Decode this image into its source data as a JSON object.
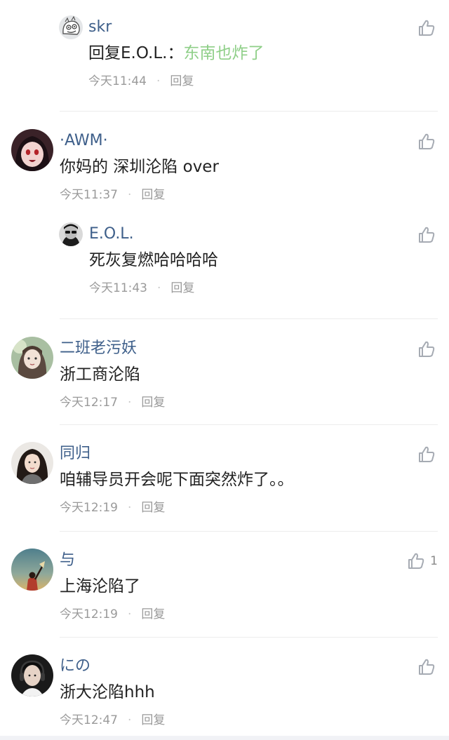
{
  "comments": [
    {
      "nick": "skr",
      "reply_prefix": "回复E.O.L.：",
      "text": "东南也炸了",
      "time": "今天11:44",
      "dot": "·",
      "reply": "回复",
      "likes": "",
      "avatar": "doodle-avatar",
      "colors": {
        "avatar_bg": "#dfe3e6"
      }
    },
    {
      "nick": "·AWM·",
      "text": "你妈的 深圳沦陷 over",
      "time": "今天11:37",
      "dot": "·",
      "reply": "回复",
      "likes": "",
      "avatar": "anime-girl-avatar",
      "colors": {
        "avatar_bg": "#3a2228"
      }
    },
    {
      "nick": "E.O.L.",
      "text": "死灰复燃哈哈哈哈",
      "time": "今天11:43",
      "dot": "·",
      "reply": "回复",
      "likes": "",
      "avatar": "sunglasses-avatar",
      "colors": {
        "avatar_bg": "#2b2b2b"
      }
    },
    {
      "nick": "二班老污妖",
      "text": "浙工商沦陷",
      "time": "今天12:17",
      "dot": "·",
      "reply": "回复",
      "likes": "",
      "avatar": "illustration-avatar",
      "colors": {
        "avatar_bg": "#9fb79a"
      }
    },
    {
      "nick": "同归",
      "text": "咱辅导员开会呢下面突然炸了。。",
      "time": "今天12:19",
      "dot": "·",
      "reply": "回复",
      "likes": "",
      "avatar": "portrait-avatar",
      "colors": {
        "avatar_bg": "#e9e6e3"
      }
    },
    {
      "nick": "与",
      "text": "上海沦陷了",
      "time": "今天12:19",
      "dot": "·",
      "reply": "回复",
      "likes": "1",
      "avatar": "sunset-figure-avatar",
      "colors": {
        "avatar_bg": "#5d8b95"
      }
    },
    {
      "nick": "にの",
      "text": "浙大沦陷hhh",
      "time": "今天12:47",
      "dot": "·",
      "reply": "回复",
      "likes": "",
      "avatar": "man-headphones-avatar",
      "colors": {
        "avatar_bg": "#1e1e1e"
      }
    }
  ],
  "theme": {
    "nick_color": "#3e5f8a",
    "highlight_color": "#8fcf88",
    "meta_color": "#9a9a9a",
    "icon_color": "#a6abb3"
  }
}
